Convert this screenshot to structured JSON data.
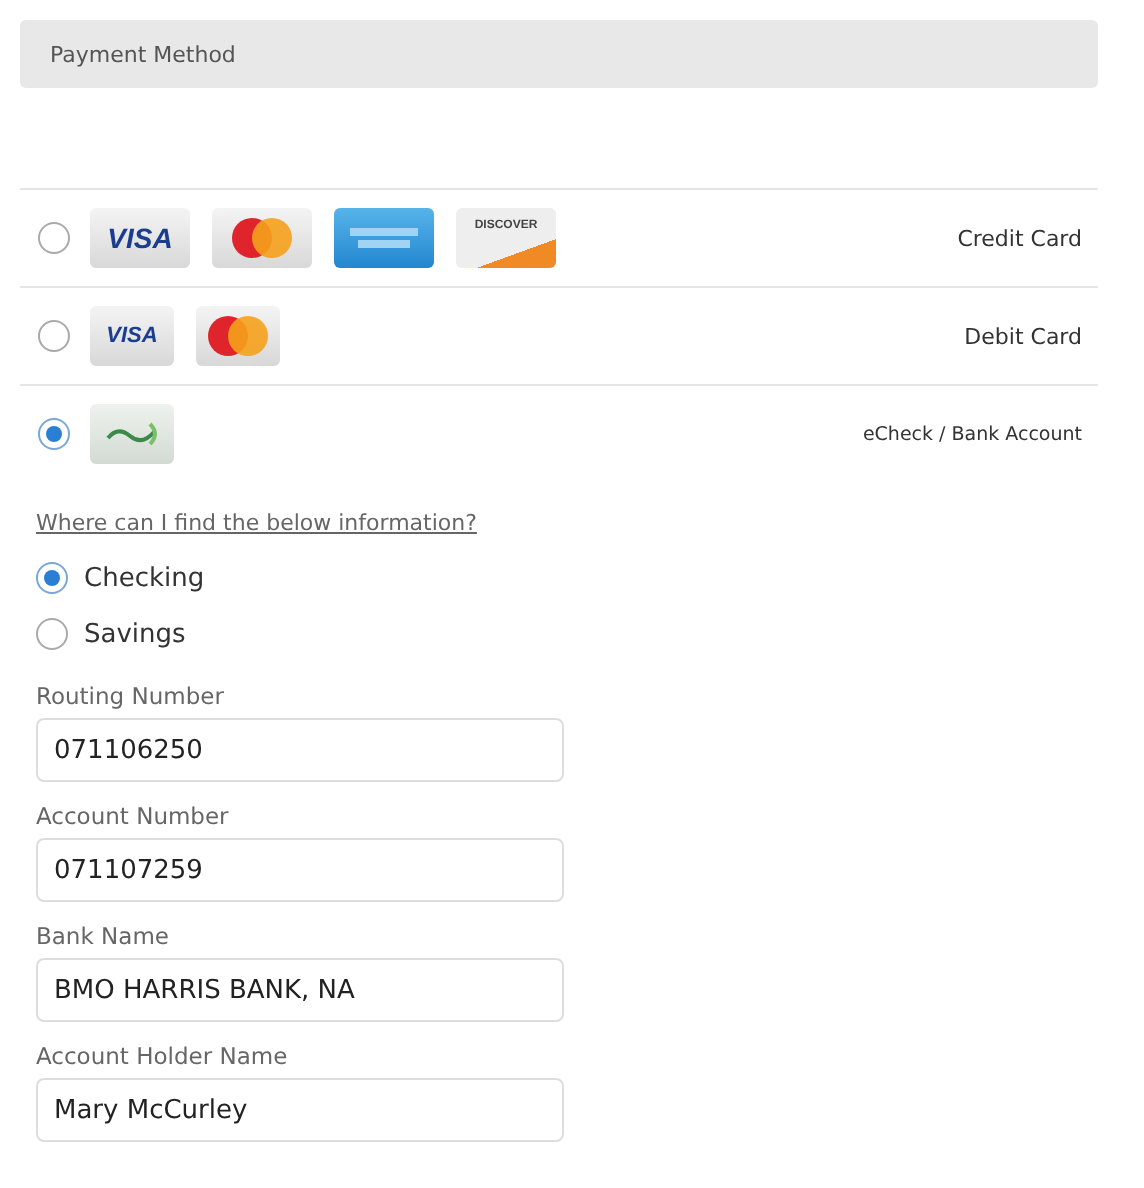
{
  "header": {
    "title": "Payment Method"
  },
  "methods": [
    {
      "label": "Credit Card",
      "selected": false,
      "logos": [
        {
          "kind": "visa",
          "text": "VISA"
        },
        {
          "kind": "mastercard"
        },
        {
          "kind": "amex"
        },
        {
          "kind": "discover",
          "text": "DISCOVER"
        }
      ]
    },
    {
      "label": "Debit Card",
      "selected": false,
      "logos": [
        {
          "kind": "visa-debit",
          "text": "VISA"
        },
        {
          "kind": "mastercard-debit"
        }
      ]
    },
    {
      "label": "eCheck / Bank Account",
      "selected": true,
      "logos": [
        {
          "kind": "echeck"
        }
      ]
    }
  ],
  "help_link": "Where can I find the below information?",
  "account_types": [
    {
      "label": "Checking",
      "selected": true
    },
    {
      "label": "Savings",
      "selected": false
    }
  ],
  "fields": [
    {
      "label": "Routing Number",
      "value": "071106250"
    },
    {
      "label": "Account Number",
      "value": "071107259"
    },
    {
      "label": "Bank Name",
      "value": "BMO HARRIS BANK, NA"
    },
    {
      "label": "Account Holder Name",
      "value": "Mary McCurley"
    }
  ]
}
